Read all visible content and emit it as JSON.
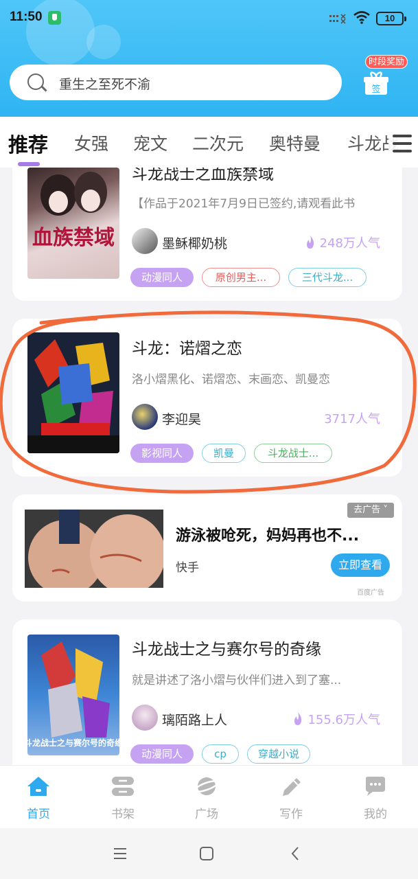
{
  "status_bar": {
    "time": "11:50",
    "battery": "10"
  },
  "search": {
    "text": "重生之至死不渝"
  },
  "reward": {
    "label": "时段奖励",
    "gift_label": "签"
  },
  "tabs": [
    {
      "label": "推荐"
    },
    {
      "label": "女强"
    },
    {
      "label": "宠文"
    },
    {
      "label": "二次元"
    },
    {
      "label": "奥特曼"
    },
    {
      "label": "斗龙战"
    }
  ],
  "books": [
    {
      "title": "斗龙战士之血族禁域",
      "desc": "【作品于2021年7月9日已签约,请观看此书",
      "author": "墨稣椰奶桃",
      "popularity": "248万人气",
      "cover_text": "血族禁域",
      "tags": [
        "动漫同人",
        "原创男主...",
        "三代斗龙..."
      ]
    },
    {
      "title": "斗龙：诺熠之恋",
      "desc": "洛小熠黑化、诺熠恋、末画恋、凯曼恋",
      "author": "李迎昊",
      "popularity": "3717人气",
      "tags": [
        "影视同人",
        "凯曼",
        "斗龙战士..."
      ]
    },
    {
      "title": "斗龙战士之与赛尔号的奇缘",
      "desc": "就是讲述了洛小熠与伙伴们进入到了塞...",
      "author": "璃陌路上人",
      "popularity": "155.6万人气",
      "cover_text": "斗龙战士之与赛尔号的奇缘",
      "tags": [
        "动漫同人",
        "cp",
        "穿越小说"
      ]
    }
  ],
  "ad": {
    "close_label": "去广告",
    "title": "游泳被呛死，妈妈再也不...",
    "source": "快手",
    "button": "立即查看",
    "ad_tag": "百度广告"
  },
  "nav": [
    {
      "label": "首页",
      "icon": "home-icon"
    },
    {
      "label": "书架",
      "icon": "bookshelf-icon"
    },
    {
      "label": "广场",
      "icon": "planet-icon"
    },
    {
      "label": "写作",
      "icon": "pen-icon"
    },
    {
      "label": "我的",
      "icon": "chat-icon"
    }
  ],
  "colors": {
    "accent": "#2fa9ee",
    "purple": "#c6a3f2",
    "header": "#3db9f4"
  }
}
